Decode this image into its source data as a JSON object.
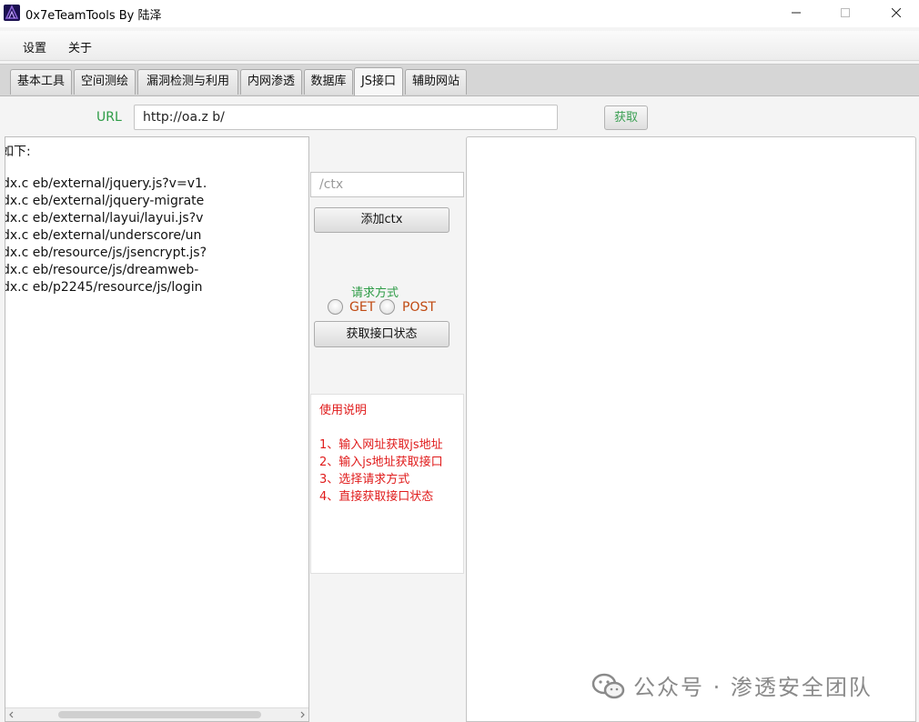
{
  "window": {
    "title": "0x7eTeamTools By 陆泽"
  },
  "menu": [
    "设置",
    "关于"
  ],
  "tabs": [
    {
      "label": "基本工具"
    },
    {
      "label": "空间测绘"
    },
    {
      "label": "漏洞检测与利用"
    },
    {
      "label": "内网渗透"
    },
    {
      "label": "数据库"
    },
    {
      "label": "JS接口",
      "active": true
    },
    {
      "label": "辅助网站"
    }
  ],
  "url": {
    "label": "URL",
    "value": "http://oa.z                              b/",
    "fetch_button": "获取"
  },
  "left_panel": {
    "lines": [
      "如下:",
      "",
      "dx.c                        eb/external/jquery.js?v=v1.",
      "dx.c                        eb/external/jquery-migrate",
      "dx.c                        eb/external/layui/layui.js?v",
      "dx.c                        eb/external/underscore/un",
      "dx.c                        eb/resource/js/jsencrypt.js?",
      "dx.c                        eb/resource/js/dreamweb-",
      "dx.c                        eb/p2245/resource/js/login"
    ]
  },
  "middle": {
    "ctx_placeholder": "/ctx",
    "add_ctx_button": "添加ctx",
    "request_method_label": "请求方式",
    "methods": [
      "GET",
      "POST"
    ],
    "get_status_button": "获取接口状态",
    "usage_title": "使用说明",
    "usage_steps": [
      "1、输入网址获取js地址",
      "2、输入js地址获取接口",
      "3、选择请求方式",
      "4、直接获取接口状态"
    ]
  },
  "watermark": "公众号 · 渗透安全团队"
}
